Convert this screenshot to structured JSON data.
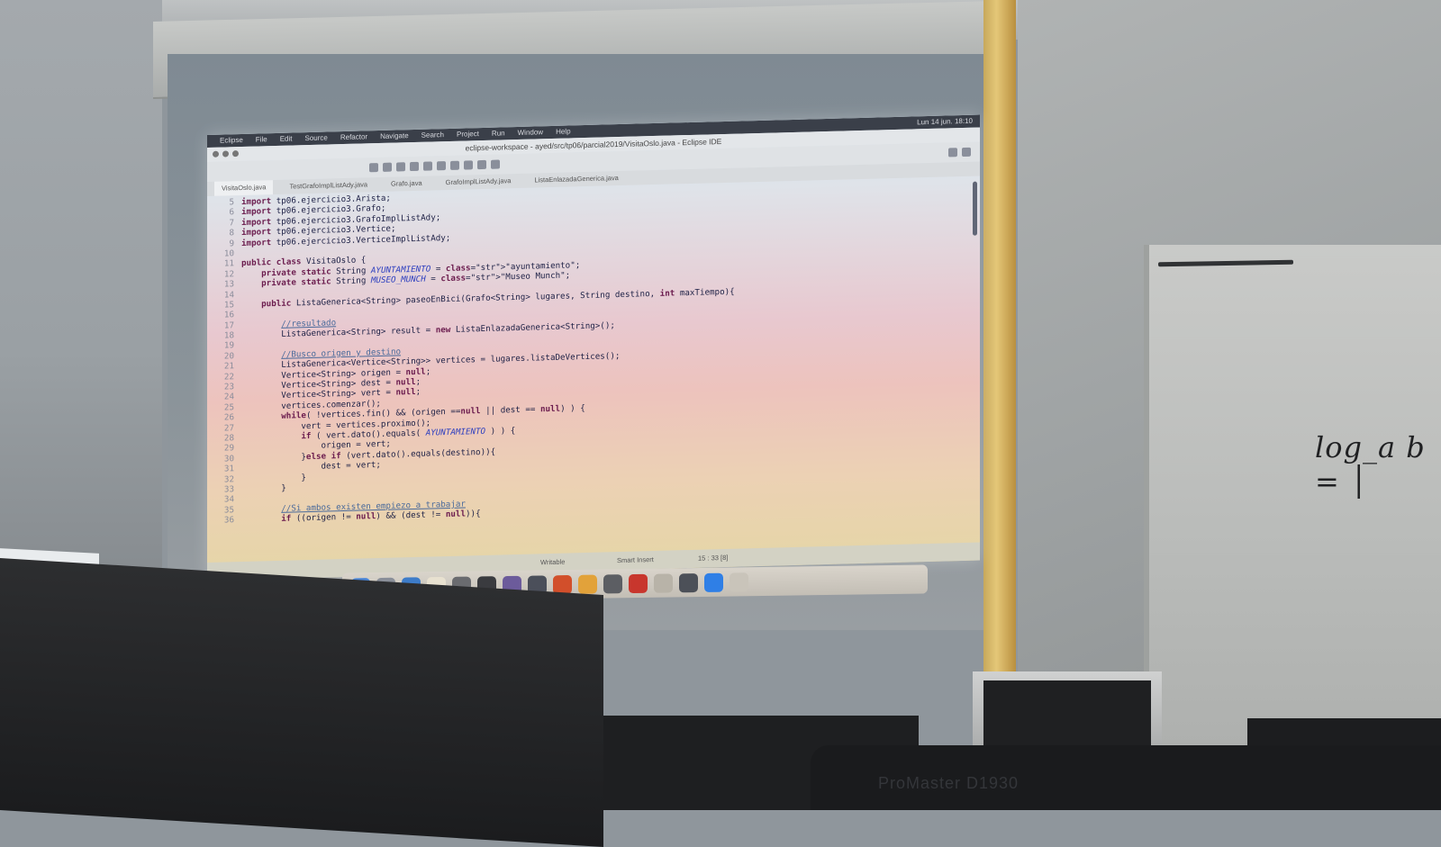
{
  "scene": "classroom-projection",
  "menubar": {
    "items": [
      "Eclipse",
      "File",
      "Edit",
      "Source",
      "Refactor",
      "Navigate",
      "Search",
      "Project",
      "Run",
      "Window",
      "Help"
    ],
    "clock": "Lun 14 jun. 18:10"
  },
  "window": {
    "title": "eclipse-workspace - ayed/src/tp06/parcial2019/VisitaOslo.java - Eclipse IDE"
  },
  "tabs": [
    "VisitaOslo.java",
    "TestGrafoImplListAdy.java",
    "Grafo.java",
    "GrafoImplListAdy.java",
    "ListaEnlazadaGenerica.java"
  ],
  "code_lines": [
    {
      "n": "5",
      "text": "import tp06.ejercicio3.Arista;"
    },
    {
      "n": "6",
      "text": "import tp06.ejercicio3.Grafo;"
    },
    {
      "n": "7",
      "text": "import tp06.ejercicio3.GrafoImplListAdy;"
    },
    {
      "n": "8",
      "text": "import tp06.ejercicio3.Vertice;"
    },
    {
      "n": "9",
      "text": "import tp06.ejercicio3.VerticeImplListAdy;"
    },
    {
      "n": "10",
      "text": ""
    },
    {
      "n": "11",
      "text": "public class VisitaOslo {"
    },
    {
      "n": "12",
      "text": "    private static String AYUNTAMIENTO = \"ayuntamiento\";"
    },
    {
      "n": "13",
      "text": "    private static String MUSEO_MUNCH = \"Museo Munch\";"
    },
    {
      "n": "14",
      "text": ""
    },
    {
      "n": "15",
      "text": "    public ListaGenerica<String> paseoEnBici(Grafo<String> lugares, String destino, int maxTiempo){"
    },
    {
      "n": "16",
      "text": ""
    },
    {
      "n": "17",
      "text": "        //resultado"
    },
    {
      "n": "18",
      "text": "        ListaGenerica<String> result = new ListaEnlazadaGenerica<String>();"
    },
    {
      "n": "19",
      "text": ""
    },
    {
      "n": "20",
      "text": "        //Busco origen y destino"
    },
    {
      "n": "21",
      "text": "        ListaGenerica<Vertice<String>> vertices = lugares.listaDeVertices();"
    },
    {
      "n": "22",
      "text": "        Vertice<String> origen = null;"
    },
    {
      "n": "23",
      "text": "        Vertice<String> dest = null;"
    },
    {
      "n": "24",
      "text": "        Vertice<String> vert = null;"
    },
    {
      "n": "25",
      "text": "        vertices.comenzar();"
    },
    {
      "n": "26",
      "text": "        while( !vertices.fin() && (origen ==null || dest == null) ) {"
    },
    {
      "n": "27",
      "text": "            vert = vertices.proximo();"
    },
    {
      "n": "28",
      "text": "            if ( vert.dato().equals( AYUNTAMIENTO ) ) {"
    },
    {
      "n": "29",
      "text": "                origen = vert;"
    },
    {
      "n": "30",
      "text": "            }else if (vert.dato().equals(destino)){"
    },
    {
      "n": "31",
      "text": "                dest = vert;"
    },
    {
      "n": "32",
      "text": "            }"
    },
    {
      "n": "33",
      "text": "        }"
    },
    {
      "n": "34",
      "text": ""
    },
    {
      "n": "35",
      "text": "        //Si ambos existen empiezo a trabajar"
    },
    {
      "n": "36",
      "text": "        if ((origen != null) && (dest != null)){"
    }
  ],
  "statusbar": {
    "mode": "Writable",
    "insert": "Smart Insert",
    "position": "15 : 33 [8]"
  },
  "whiteboard": {
    "text": "log_a b = │"
  },
  "monitor_label": "ProMaster D1930",
  "colors": {
    "keyword": "#6b1c4e",
    "string": "#2a3bd8",
    "comment": "#4a6a9b",
    "text": "#1e2146"
  }
}
